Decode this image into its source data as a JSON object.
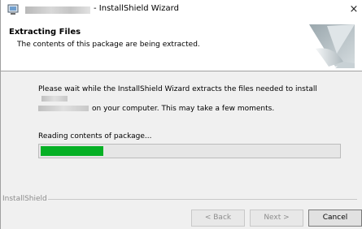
{
  "window": {
    "title": "- InstallShield Wizard",
    "close_glyph": "×"
  },
  "header": {
    "title": "Extracting Files",
    "subtitle": "The contents of this package are being extracted."
  },
  "body": {
    "line1": "Please wait while the InstallShield Wizard extracts the files needed to install",
    "line2": "on your computer.  This may take a few moments."
  },
  "progress": {
    "status": "Reading contents of package...",
    "fraction": 0.21,
    "fill_color": "#06b025"
  },
  "footer": {
    "brand": "InstallShield",
    "back_label": "< Back",
    "next_label": "Next >",
    "cancel_label": "Cancel"
  },
  "icons": {
    "app": "installer-app-icon",
    "banner": "page-curl-banner-icon"
  }
}
